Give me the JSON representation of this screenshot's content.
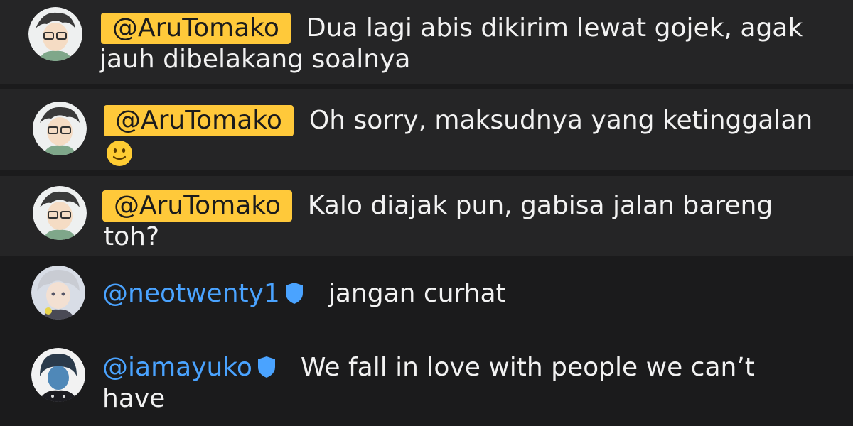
{
  "messages": [
    {
      "mention": "@AruTomako",
      "line1": "Dua lagi abis dikirim lewat gojek, agak",
      "line2": "jauh dibelakang soalnya"
    },
    {
      "mention": "@AruTomako",
      "line1": "Oh sorry, maksudnya yang ketinggalan",
      "emoji": "slightly-smiling-face"
    },
    {
      "mention": "@AruTomako",
      "line1": "Kalo diajak pun, gabisa jalan bareng",
      "line2": "toh?"
    },
    {
      "username": "@neotwenty1",
      "line1": "jangan curhat"
    },
    {
      "username": "@iamayuko",
      "line1": "We fall in love with people we can’t",
      "line2": "have"
    }
  ],
  "colors": {
    "mention_bg": "#ffc93a",
    "username": "#4aa3ff",
    "verified": "#4aa3ff",
    "text": "#f2f2f2",
    "row_bg": "#252526",
    "bg": "#1b1b1c"
  }
}
